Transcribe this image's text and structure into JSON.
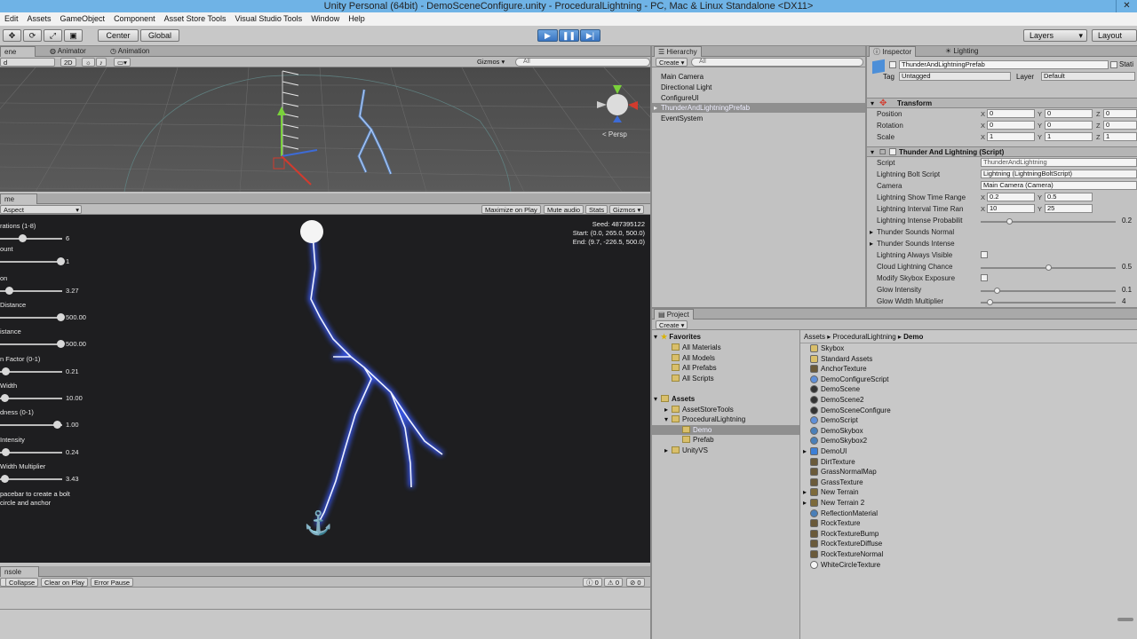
{
  "window": {
    "title": "Unity Personal (64bit) - DemoSceneConfigure.unity - ProceduralLightning - PC, Mac & Linux Standalone <DX11>"
  },
  "menu": [
    "Edit",
    "Assets",
    "GameObject",
    "Component",
    "Asset Store Tools",
    "Visual Studio Tools",
    "Window",
    "Help"
  ],
  "toolbar": {
    "center": "Center",
    "global": "Global",
    "layers": "Layers",
    "layout": "Layout"
  },
  "scene": {
    "tabs": [
      "ene",
      "Animator",
      "Animation"
    ],
    "mode": "d",
    "twod": "2D",
    "gizmos": "Gizmos",
    "search": "All",
    "persp": "< Persp"
  },
  "game": {
    "tab": "me",
    "aspect": "Aspect",
    "buttons": [
      "Maximize on Play",
      "Mute audio",
      "Stats",
      "Gizmos"
    ],
    "seed": "Seed: 487395122",
    "start": "Start: (0.0, 265.0, 500.0)",
    "end": "End: (9.7, -226.5, 500.0)",
    "sliders": [
      {
        "label": "rations (1-8)",
        "value": "6",
        "pos": 0.33
      },
      {
        "label": "ount",
        "value": "1",
        "pos": 1.0
      },
      {
        "label": "on",
        "value": "3.27",
        "pos": 0.1
      },
      {
        "label": "Distance",
        "value": "500.00",
        "pos": 1.0
      },
      {
        "label": "istance",
        "value": "500.00",
        "pos": 1.0
      },
      {
        "label": "n Factor (0-1)",
        "value": "0.21",
        "pos": 0.03
      },
      {
        "label": "Width",
        "value": "10.00",
        "pos": 0.02
      },
      {
        "label": "dness (0-1)",
        "value": "1.00",
        "pos": 0.93
      },
      {
        "label": "Intensity",
        "value": "0.24",
        "pos": 0.03
      },
      {
        "label": "Width Multiplier",
        "value": "3.43",
        "pos": 0.02
      }
    ],
    "hint1": "pacebar to create a bolt",
    "hint2": "circle and anchor"
  },
  "console": {
    "tab": "nsole",
    "buttons": [
      "Collapse",
      "Clear on Play",
      "Error Pause"
    ],
    "counts": [
      "0",
      "0",
      "0"
    ]
  },
  "hierarchy": {
    "tab": "Hierarchy",
    "create": "Create",
    "search": "All",
    "items": [
      "Main Camera",
      "Directional Light",
      "ConfigureUI",
      "ThunderAndLightningPrefab",
      "EventSystem"
    ]
  },
  "inspector": {
    "tabs": [
      "Inspector",
      "Lighting"
    ],
    "object_name": "ThunderAndLightningPrefab",
    "static": "Stati",
    "tag_label": "Tag",
    "tag_value": "Untagged",
    "layer_label": "Layer",
    "layer_value": "Default",
    "transform": {
      "title": "Transform",
      "rows": [
        {
          "label": "Position",
          "x": "0",
          "y": "0",
          "z": "0"
        },
        {
          "label": "Rotation",
          "x": "0",
          "y": "0",
          "z": "0"
        },
        {
          "label": "Scale",
          "x": "1",
          "y": "1",
          "z": "1"
        }
      ]
    },
    "script": {
      "title": "Thunder And Lightning (Script)",
      "script_label": "Script",
      "script_value": "ThunderAndLightning",
      "bolt_label": "Lightning Bolt Script",
      "bolt_value": "Lightning (LightningBoltScript)",
      "camera_label": "Camera",
      "camera_value": "Main Camera (Camera)",
      "show_label": "Lightning Show Time Range",
      "show_x": "0.2",
      "show_y": "0.5",
      "interval_label": "Lightning Interval Time Ran",
      "interval_x": "10",
      "interval_y": "25",
      "intense_label": "Lightning Intense Probabilit",
      "intense_value": "0.2",
      "intense_pos": 0.2,
      "normal_label": "Thunder Sounds Normal",
      "intense_sounds_label": "Thunder Sounds Intense",
      "visible_label": "Lightning Always Visible",
      "cloud_label": "Cloud Lightning Chance",
      "cloud_value": "0.5",
      "cloud_pos": 0.5,
      "skybox_label": "Modify Skybox Exposure",
      "glow_label": "Glow Intensity",
      "glow_value": "0.1",
      "glow_pos": 0.1,
      "glowwidth_label": "Glow Width Multiplier",
      "glowwidth_value": "4",
      "glowwidth_pos": 0.05
    }
  },
  "project": {
    "tab": "Project",
    "create": "Create",
    "favorites": {
      "title": "Favorites",
      "items": [
        "All Materials",
        "All Models",
        "All Prefabs",
        "All Scripts"
      ]
    },
    "assets": {
      "title": "Assets",
      "items": [
        "AssetStoreTools",
        "ProceduralLightning",
        "Demo",
        "Prefab",
        "UnityVS"
      ]
    },
    "breadcrumb": [
      "Assets",
      "ProceduralLightning",
      "Demo"
    ],
    "files": [
      "Skybox",
      "Standard Assets",
      "AnchorTexture",
      "DemoConfigureScript",
      "DemoScene",
      "DemoScene2",
      "DemoSceneConfigure",
      "DemoScript",
      "DemoSkybox",
      "DemoSkybox2",
      "DemoUI",
      "DirtTexture",
      "GrassNormalMap",
      "GrassTexture",
      "New Terrain",
      "New Terrain 2",
      "ReflectionMaterial",
      "RockTexture",
      "RockTextureBump",
      "RockTextureDiffuse",
      "RockTextureNormal",
      "WhiteCircleTexture"
    ]
  }
}
